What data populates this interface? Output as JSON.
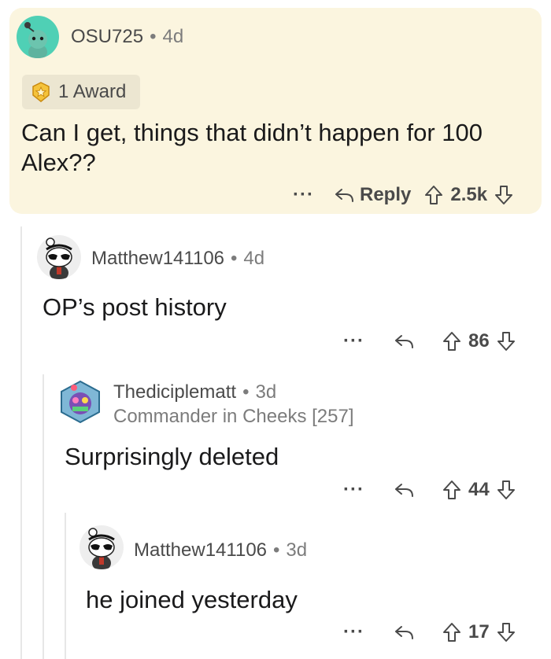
{
  "comments": [
    {
      "username": "OSU725",
      "age": "4d",
      "award_label": "1 Award",
      "body_line1": "Can I get, things that didn’t happen for 100",
      "body_line2": "Alex??",
      "more": "···",
      "reply_label": "Reply",
      "votes": "2.5k"
    },
    {
      "username": "Matthew141106",
      "age": "4d",
      "body": "OP’s post history",
      "more": "···",
      "votes": "86"
    },
    {
      "username": "Thediciplematt",
      "age": "3d",
      "flair": "Commander in Cheeks [257]",
      "body": "Surprisingly deleted",
      "more": "···",
      "votes": "44"
    },
    {
      "username": "Matthew141106",
      "age": "3d",
      "body": "he joined yesterday",
      "more": "···",
      "votes": "17"
    }
  ],
  "separator": "•",
  "colors": {
    "highlight_bg": "#fbf5df",
    "award_bg": "#ece6d1",
    "avatar_teal": "#4fd0b5",
    "meta_gray": "#7c7c7c"
  },
  "icons": [
    "reddit-snoo-avatar-icon",
    "award-icon",
    "reply-arrow-icon",
    "upvote-icon",
    "downvote-icon"
  ]
}
